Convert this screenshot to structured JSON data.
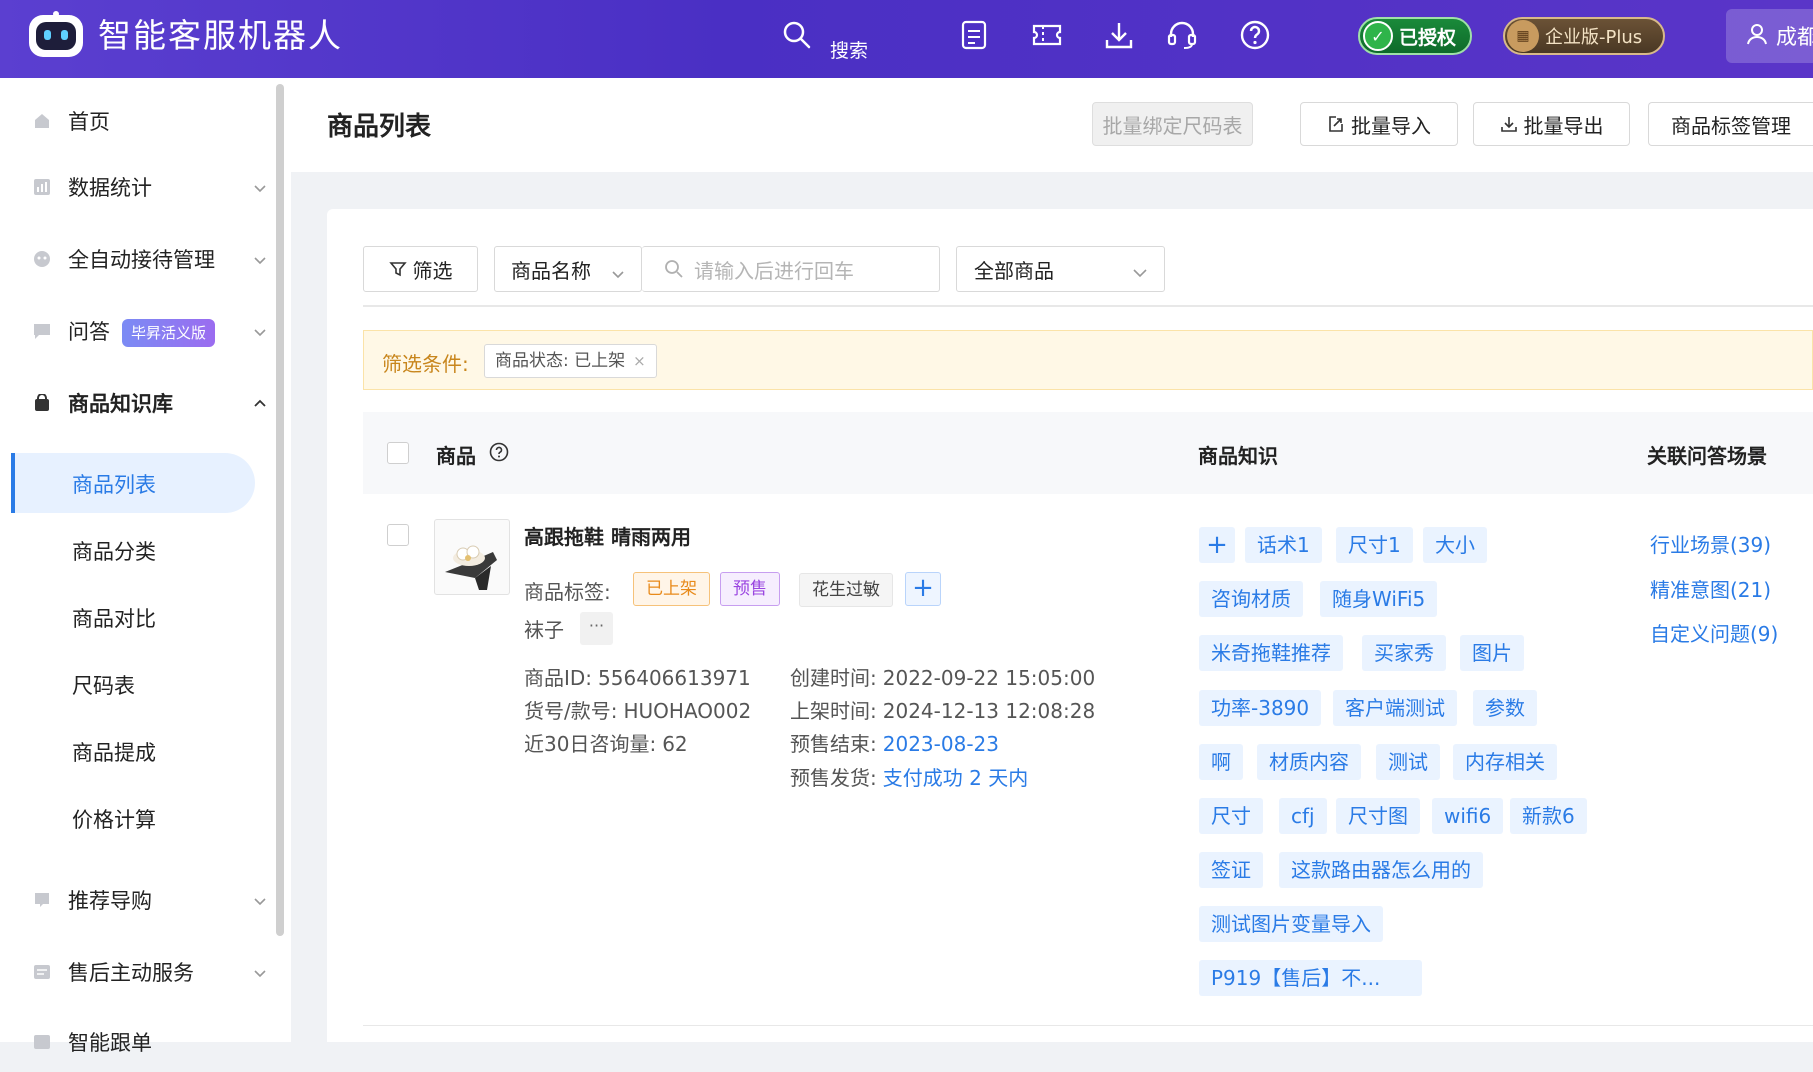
{
  "header": {
    "app_title": "智能客服机器人",
    "search_label": "搜索",
    "auth_badge": "已授权",
    "edition_badge": "企业版-Plus",
    "user_name": "成都"
  },
  "sidebar": {
    "items": [
      {
        "label": "首页",
        "icon": "home-icon"
      },
      {
        "label": "数据统计",
        "icon": "chart-icon"
      },
      {
        "label": "全自动接待管理",
        "icon": "robot-icon"
      },
      {
        "label": "问答",
        "icon": "chat-icon",
        "tag": "毕昇活义版"
      },
      {
        "label": "商品知识库",
        "icon": "bag-icon"
      },
      {
        "label": "推荐导购",
        "icon": "recommend-icon"
      },
      {
        "label": "售后主动服务",
        "icon": "service-icon"
      },
      {
        "label": "智能跟单",
        "icon": "follow-icon"
      }
    ],
    "subitems": [
      {
        "label": "商品列表"
      },
      {
        "label": "商品分类"
      },
      {
        "label": "商品对比"
      },
      {
        "label": "尺码表"
      },
      {
        "label": "商品提成"
      },
      {
        "label": "价格计算"
      }
    ]
  },
  "toolbar": {
    "page_title": "商品列表",
    "bind_size_label": "批量绑定尺码表",
    "import_label": "批量导入",
    "export_label": "批量导出",
    "tag_manage_label": "商品标签管理"
  },
  "filters": {
    "filter_label": "筛选",
    "field_select": "商品名称",
    "search_placeholder": "请输入后进行回车",
    "scope_select": "全部商品",
    "condition_label": "筛选条件:",
    "condition_chip": "商品状态: 已上架"
  },
  "table": {
    "headers": {
      "product": "商品",
      "knowledge": "商品知识",
      "scenes": "关联问答场景"
    },
    "row": {
      "title": "高跟拖鞋 晴雨两用",
      "tags_label": "商品标签:",
      "tag_onshelf": "已上架",
      "tag_presale": "预售",
      "tag_peanut": "花生过敏",
      "tag_sock": "袜子",
      "more": "···",
      "product_id_label": "商品ID:",
      "product_id": "556406613971",
      "sku_label": "货号/款号:",
      "sku": "HUOHAO002",
      "inquiries_label": "近30日咨询量:",
      "inquiries": "62",
      "created_label": "创建时间:",
      "created": "2022-09-22 15:05:00",
      "listed_label": "上架时间:",
      "listed": "2024-12-13 12:08:28",
      "presale_end_label": "预售结束:",
      "presale_end": "2023-08-23",
      "presale_ship_label": "预售发货:",
      "presale_ship": "支付成功 2 天内",
      "knowledge": [
        "话术1",
        "尺寸1",
        "大小",
        "咨询材质",
        "随身WiFi5",
        "米奇拖鞋推荐",
        "买家秀",
        "图片",
        "功率-3890",
        "客户端测试",
        "参数",
        "啊",
        "材质内容",
        "测试",
        "内存相关",
        "尺寸",
        "cfj",
        "尺寸图",
        "wifi6",
        "新款6",
        "签证",
        "这款路由器怎么用的",
        "测试图片变量导入",
        "P919【售后】不..."
      ],
      "scenes": [
        "行业场景(39)",
        "精准意图(21)",
        "自定义问题(9)"
      ]
    }
  },
  "colors": {
    "header_bg": "#4a2fc4",
    "accent": "#2a7be6",
    "filter_bg": "#fff8e6"
  }
}
